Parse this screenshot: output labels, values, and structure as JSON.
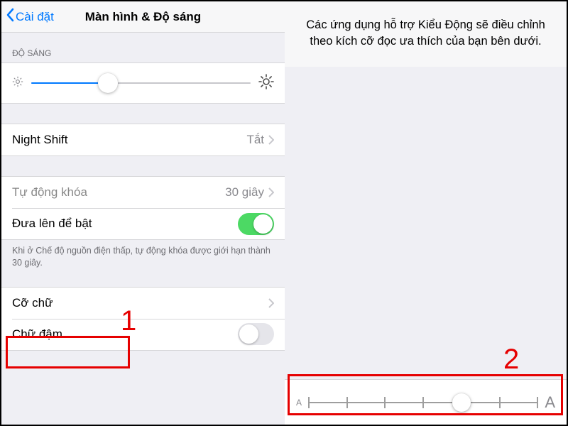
{
  "left": {
    "back_label": "Cài đặt",
    "title": "Màn hình & Độ sáng",
    "brightness_header": "ĐỘ SÁNG",
    "brightness_percent": 35,
    "night_shift_label": "Night Shift",
    "night_shift_value": "Tắt",
    "auto_lock_label": "Tự động khóa",
    "auto_lock_value": "30 giây",
    "raise_to_wake_label": "Đưa lên để bật",
    "raise_to_wake_on": true,
    "low_power_note": "Khi ở Chế độ nguồn điện thấp, tự động khóa được giới hạn thành 30 giây.",
    "text_size_label": "Cỡ chữ",
    "bold_text_label": "Chữ đậm",
    "bold_on": false
  },
  "right": {
    "description": "Các ứng dụng hỗ trợ Kiểu Động sẽ điều chỉnh theo kích cỡ đọc ưa thích của bạn bên dưới.",
    "A_small": "A",
    "A_large": "A",
    "ticks": 7,
    "selected_index": 4
  },
  "annotations": {
    "one": "1",
    "two": "2"
  }
}
